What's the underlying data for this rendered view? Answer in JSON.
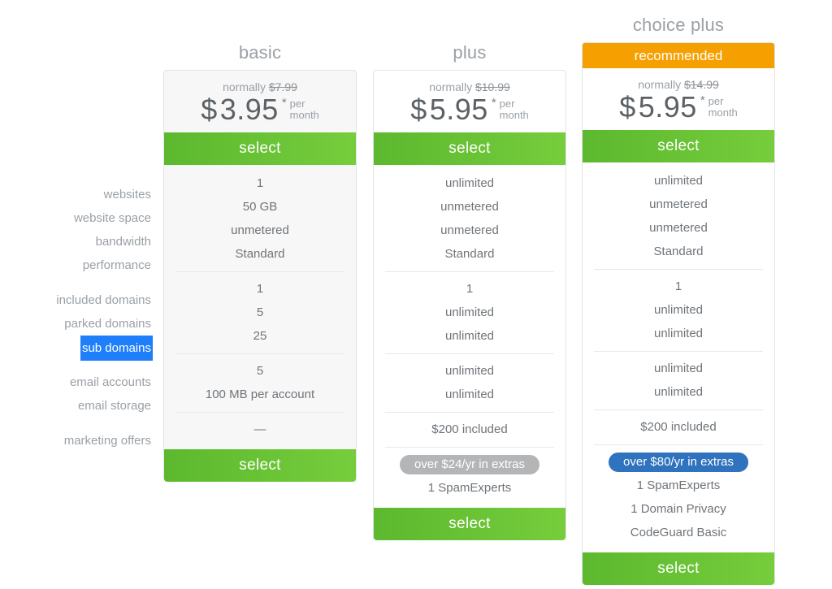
{
  "feature_labels": [
    {
      "text": "websites",
      "selected": false
    },
    {
      "text": "website space",
      "selected": false
    },
    {
      "text": "bandwidth",
      "selected": false
    },
    {
      "text": "performance",
      "selected": false
    },
    {
      "text": "included domains",
      "selected": false
    },
    {
      "text": "parked domains",
      "selected": false
    },
    {
      "text": "sub domains",
      "selected": true
    },
    {
      "text": "email accounts",
      "selected": false
    },
    {
      "text": "email storage",
      "selected": false
    },
    {
      "text": "marketing offers",
      "selected": false
    }
  ],
  "select_label": "select",
  "recommended_label": "recommended",
  "colors": {
    "green": "#5cb82e",
    "green_light": "#76cd3c",
    "orange": "#f5a000",
    "blue_pill": "#2f72bd",
    "grey_pill": "#b3b5b7",
    "selection_blue": "#1f7ffb",
    "card_muted": "#f7f7f7",
    "text": "#6f7479",
    "label_text": "#9aa0a6"
  },
  "plans": [
    {
      "name": "basic",
      "recommended": false,
      "normally_prefix": "normally",
      "normally_price": "$7.99",
      "currency": "$",
      "price": "3.95",
      "asterisk": "*",
      "per": "per",
      "month": "month",
      "features": {
        "websites": "1",
        "website_space": "50 GB",
        "bandwidth": "unmetered",
        "performance": "Standard",
        "included_domains": "1",
        "parked_domains": "5",
        "sub_domains": "25",
        "email_accounts": "5",
        "email_storage": "100 MB per account",
        "marketing_offers": "—"
      },
      "extras_pill": null,
      "extras_items": []
    },
    {
      "name": "plus",
      "recommended": false,
      "normally_prefix": "normally",
      "normally_price": "$10.99",
      "currency": "$",
      "price": "5.95",
      "asterisk": "*",
      "per": "per",
      "month": "month",
      "features": {
        "websites": "unlimited",
        "website_space": "unmetered",
        "bandwidth": "unmetered",
        "performance": "Standard",
        "included_domains": "1",
        "parked_domains": "unlimited",
        "sub_domains": "unlimited",
        "email_accounts": "unlimited",
        "email_storage": "unlimited",
        "marketing_offers": "$200 included"
      },
      "extras_pill": "over $24/yr in extras",
      "extras_items": [
        "1 SpamExperts"
      ]
    },
    {
      "name": "choice plus",
      "recommended": true,
      "normally_prefix": "normally",
      "normally_price": "$14.99",
      "currency": "$",
      "price": "5.95",
      "asterisk": "*",
      "per": "per",
      "month": "month",
      "features": {
        "websites": "unlimited",
        "website_space": "unmetered",
        "bandwidth": "unmetered",
        "performance": "Standard",
        "included_domains": "1",
        "parked_domains": "unlimited",
        "sub_domains": "unlimited",
        "email_accounts": "unlimited",
        "email_storage": "unlimited",
        "marketing_offers": "$200 included"
      },
      "extras_pill": "over $80/yr in extras",
      "extras_items": [
        "1 SpamExperts",
        "1 Domain Privacy",
        "CodeGuard Basic"
      ]
    }
  ]
}
